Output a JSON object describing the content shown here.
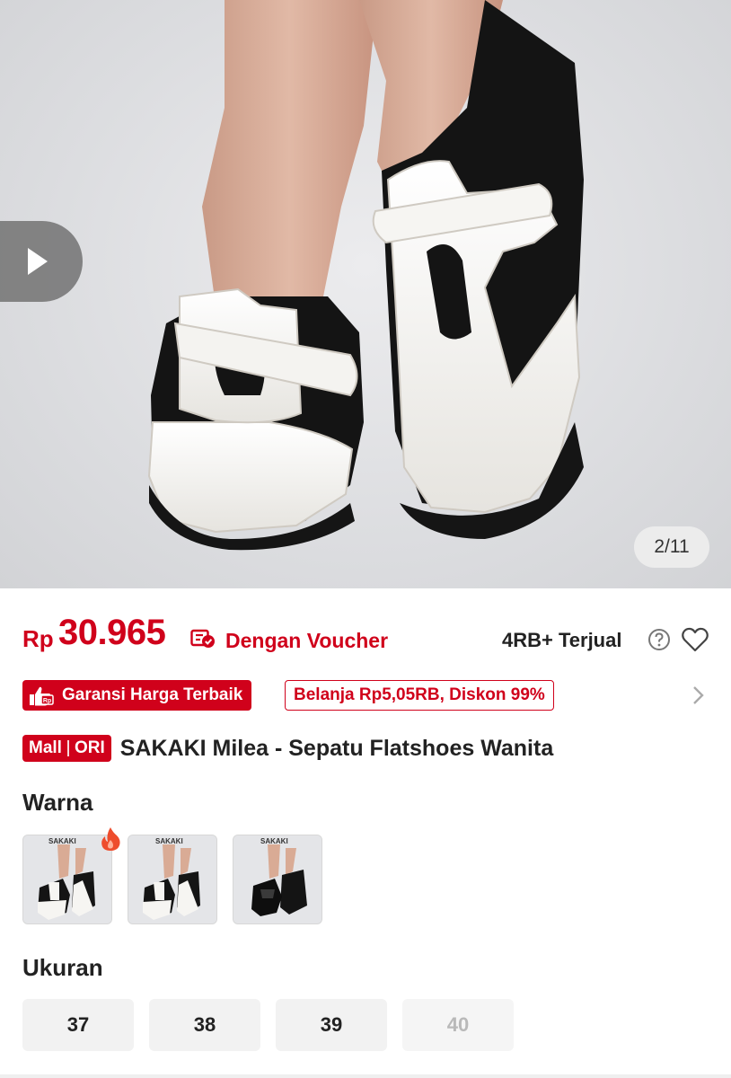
{
  "gallery": {
    "counter": "2/11",
    "play_icon": "play-icon"
  },
  "price": {
    "currency": "Rp",
    "value": "30.965",
    "voucher_label": "Dengan Voucher",
    "sold_label": "4RB+ Terjual"
  },
  "promo": {
    "guarantee_label": "Garansi Harga Terbaik",
    "discount_label": "Belanja Rp5,05RB, Diskon 99%"
  },
  "product": {
    "badge_left": "Mall",
    "badge_right": "ORI",
    "title": "SAKAKI Milea - Sepatu Flatshoes Wanita"
  },
  "color_section": {
    "label": "Warna",
    "options": [
      {
        "brand_text": "SAKAKI"
      },
      {
        "brand_text": "SAKAKI"
      },
      {
        "brand_text": "SAKAKI"
      }
    ]
  },
  "size_section": {
    "label": "Ukuran",
    "options": [
      {
        "label": "37",
        "available": true
      },
      {
        "label": "38",
        "available": true
      },
      {
        "label": "39",
        "available": true
      },
      {
        "label": "40",
        "available": false
      }
    ]
  },
  "colors": {
    "accent": "#d0011b",
    "text": "#222222",
    "disabled_text": "#b9b9b9"
  }
}
